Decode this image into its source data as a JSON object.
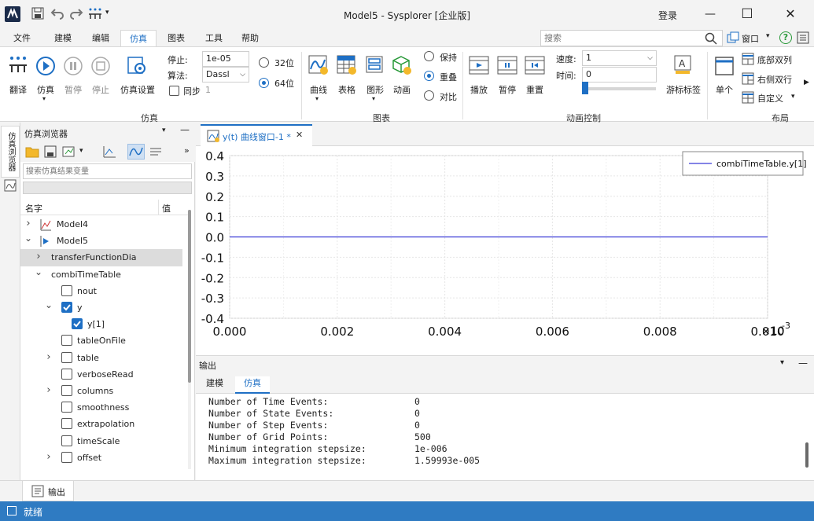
{
  "window": {
    "title": "Model5 - Sysplorer [企业版]",
    "login": "登录",
    "min": "—",
    "max": "☐",
    "close": "✕"
  },
  "menu": [
    "文件",
    "建模",
    "编辑",
    "仿真",
    "图表",
    "工具",
    "帮助"
  ],
  "search": {
    "placeholder": "搜索"
  },
  "right_tools": {
    "window_label": "窗口",
    "help": "?"
  },
  "ribbon": {
    "sim": {
      "translate": "翻译",
      "simulate": "仿真",
      "pause": "暂停",
      "stop": "停止",
      "settings": "仿真设置",
      "stop_label": "停止:",
      "stop_value": "1e-05",
      "algo_label": "算法:",
      "algo_value": "Dassl",
      "sync_label": "同步",
      "sync_value": "1",
      "bit32": "32位",
      "bit64": "64位",
      "group": "仿真"
    },
    "chart": {
      "curve": "曲线",
      "table": "表格",
      "graph": "图形",
      "anim": "动画",
      "keep": "保持",
      "overlay": "重叠",
      "compare": "对比",
      "group": "图表"
    },
    "anim": {
      "play": "播放",
      "pause": "暂停",
      "reset": "重置",
      "speed_label": "速度:",
      "speed_value": "1",
      "time_label": "时间:",
      "time_value": "0",
      "cursor": "游标标签",
      "group": "动画控制"
    },
    "layout": {
      "single": "单个",
      "bottom": "底部双列",
      "right": "右侧双行",
      "custom": "自定义",
      "group": "布局"
    }
  },
  "browser": {
    "title": "仿真浏览器",
    "side_tab": "仿真浏览器",
    "search_placeholder": "搜索仿真结果变量",
    "col_name": "名字",
    "col_value": "值",
    "tree": [
      {
        "label": "Model4",
        "indent": 0,
        "exp": "›",
        "icon": "model4"
      },
      {
        "label": "Model5",
        "indent": 0,
        "exp": "⌄",
        "icon": "model5"
      },
      {
        "label": "transferFunctionDia",
        "indent": 1,
        "exp": "›",
        "icon": "none",
        "selected": true
      },
      {
        "label": "combiTimeTable",
        "indent": 1,
        "exp": "⌄",
        "icon": "none"
      },
      {
        "label": "nout",
        "indent": 2,
        "exp": "",
        "icon": "cb"
      },
      {
        "label": "y",
        "indent": 2,
        "exp": "⌄",
        "icon": "cb-on"
      },
      {
        "label": "y[1]",
        "indent": 3,
        "exp": "",
        "icon": "cb-on"
      },
      {
        "label": "tableOnFile",
        "indent": 2,
        "exp": "",
        "icon": "cb"
      },
      {
        "label": "table",
        "indent": 2,
        "exp": "›",
        "icon": "cb"
      },
      {
        "label": "verboseRead",
        "indent": 2,
        "exp": "",
        "icon": "cb"
      },
      {
        "label": "columns",
        "indent": 2,
        "exp": "›",
        "icon": "cb"
      },
      {
        "label": "smoothness",
        "indent": 2,
        "exp": "",
        "icon": "cb"
      },
      {
        "label": "extrapolation",
        "indent": 2,
        "exp": "",
        "icon": "cb"
      },
      {
        "label": "timeScale",
        "indent": 2,
        "exp": "",
        "icon": "cb"
      },
      {
        "label": "offset",
        "indent": 2,
        "exp": "›",
        "icon": "cb"
      }
    ]
  },
  "plot": {
    "tab_label": "y(t) 曲线窗口-1 *",
    "tab_close": "✕",
    "legend": "combiTimeTable.y[1]",
    "x_exponent": "×10",
    "x_exponent_power": "-3"
  },
  "chart_data": {
    "type": "line",
    "title": "",
    "xlabel": "",
    "ylabel": "",
    "xlim": [
      0,
      0.01
    ],
    "ylim": [
      -0.4,
      0.4
    ],
    "x_ticks": [
      "0.000",
      "0.002",
      "0.004",
      "0.006",
      "0.008",
      "0.010"
    ],
    "y_ticks": [
      "0.4",
      "0.3",
      "0.2",
      "0.1",
      "0.0",
      "-0.1",
      "-0.2",
      "-0.3",
      "-0.4"
    ],
    "series": [
      {
        "name": "combiTimeTable.y[1]",
        "color": "#3a3ad6",
        "x": [
          0,
          0.01
        ],
        "y": [
          0,
          0
        ]
      }
    ],
    "grid": true,
    "legend_position": "top-right"
  },
  "output": {
    "title": "输出",
    "tabs": [
      "建模",
      "仿真"
    ],
    "lines": [
      {
        "k": "Number of Time Events:",
        "v": "0"
      },
      {
        "k": "Number of State Events:",
        "v": "0"
      },
      {
        "k": "Number of Step Events:",
        "v": "0"
      },
      {
        "k": "Number of Grid Points:",
        "v": "500"
      },
      {
        "k": "Minimum integration stepsize:",
        "v": "1e-006"
      },
      {
        "k": "Maximum integration stepsize:",
        "v": "1.59993e-005"
      }
    ],
    "bottom_tab": "输出"
  },
  "status": {
    "text": "就绪"
  },
  "colors": {
    "accent": "#1e6fc4",
    "status_bar": "#2f7bc2",
    "plot_line": "#3a3ad6"
  }
}
